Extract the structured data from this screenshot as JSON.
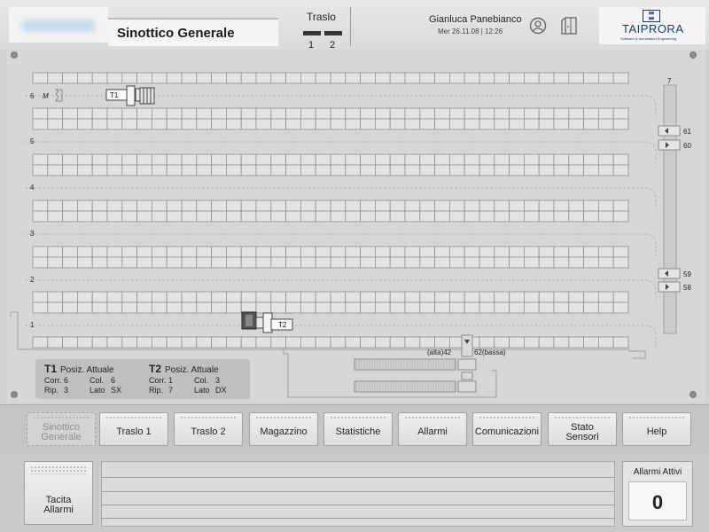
{
  "header": {
    "title": "Sinottico Generale",
    "traslo_label": "Traslo",
    "traslo_numbers": [
      "1",
      "2"
    ],
    "user_name": "Gianluca Panebianco",
    "date_time": "Mer 26.11.08 | 12:26",
    "logo_name": "TAIPRORA",
    "logo_sub": "Software & Automation Engineering"
  },
  "synoptic": {
    "row_labels": [
      "6",
      "5",
      "4",
      "3",
      "2",
      "1"
    ],
    "lift_labels": [
      "7",
      "61",
      "60",
      "59",
      "58"
    ],
    "m_label": "M",
    "trolleys": [
      {
        "label": "T1"
      },
      {
        "label": "T2"
      }
    ],
    "alta_label": "(alta)42",
    "bassa_label": "62(bassa)"
  },
  "position": {
    "t1": {
      "id": "T1",
      "title": "Posiz. Attuale",
      "corr_label": "Corr.",
      "corr": "6",
      "col_label": "Col.",
      "col": "6",
      "rip_label": "Rip.",
      "rip": "3",
      "lato_label": "Lato",
      "lato": "SX"
    },
    "t2": {
      "id": "T2",
      "title": "Posiz. Attuale",
      "corr_label": "Corr.",
      "corr": "1",
      "col_label": "Col.",
      "col": "3",
      "rip_label": "Rip.",
      "rip": "7",
      "lato_label": "Lato",
      "lato": "DX"
    }
  },
  "nav": {
    "items": [
      {
        "l1": "Sinottico",
        "l2": "Generale"
      },
      {
        "l1": "Traslo 1",
        "l2": ""
      },
      {
        "l1": "Traslo 2",
        "l2": ""
      },
      {
        "l1": "Magazzino",
        "l2": ""
      },
      {
        "l1": "Statistiche",
        "l2": ""
      },
      {
        "l1": "Allarmi",
        "l2": ""
      },
      {
        "l1": "Comunicazioni",
        "l2": ""
      },
      {
        "l1": "Stato",
        "l2": "Sensori"
      },
      {
        "l1": "Help",
        "l2": ""
      }
    ]
  },
  "bottom": {
    "tacita_l1": "Tacita",
    "tacita_l2": "Allarmi",
    "alarms_active_label": "Allarmi Attivi",
    "alarms_active_count": "0"
  }
}
